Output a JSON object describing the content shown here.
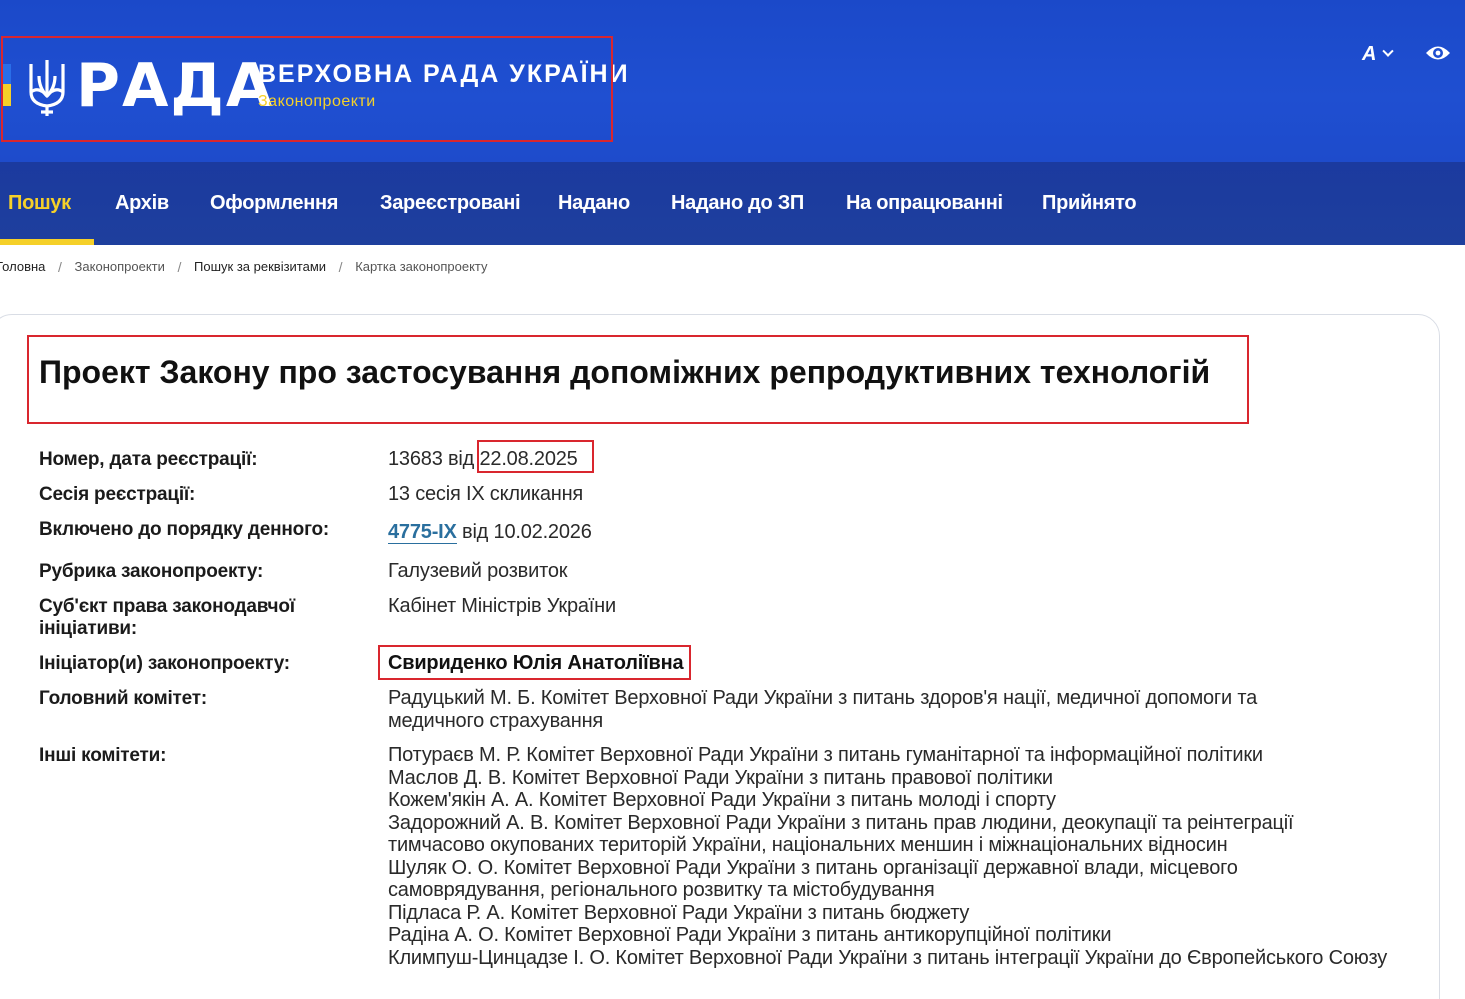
{
  "header": {
    "logo_word": "РАДА",
    "title": "ВЕРХОВНА РАДА УКРАЇНИ",
    "subtitle": "Законопроекти",
    "font_toggle_label": "A"
  },
  "nav": {
    "items": [
      {
        "label": "Пошук",
        "active": true
      },
      {
        "label": "Архів"
      },
      {
        "label": "Оформлення"
      },
      {
        "label": "Зареєстровані"
      },
      {
        "label": "Надано"
      },
      {
        "label": "Надано до ЗП"
      },
      {
        "label": "На опрацюванні"
      },
      {
        "label": "Прийнято"
      }
    ]
  },
  "breadcrumb": {
    "items": [
      "Головна",
      "Законопроекти",
      "Пошук за реквізитами",
      "Картка законопроекту"
    ],
    "separator": "/"
  },
  "bill": {
    "title": "Проект Закону про застосування допоміжних репродуктивних технологій",
    "rows": {
      "number": {
        "label": "Номер, дата реєстрації:",
        "number": "13683",
        "from": "від",
        "date": "22.08.2025"
      },
      "session": {
        "label": "Сесія реєстрації:",
        "value": "13 сесія IX скликання"
      },
      "agenda": {
        "label": "Включено до порядку денного:",
        "link": "4775-IX",
        "from": "від",
        "date": "10.02.2026"
      },
      "rubric": {
        "label": "Рубрика законопроекту:",
        "value": "Галузевий розвиток"
      },
      "subject": {
        "label": "Суб'єкт права законодавчої ініціативи:",
        "value": "Кабінет Міністрів України"
      },
      "initiator": {
        "label": "Ініціатор(и) законопроекту:",
        "value": "Свириденко Юлія Анатоліївна"
      },
      "main_committee": {
        "label": "Головний комітет:",
        "value": "Радуцький М. Б. Комітет Верховної Ради України з питань здоров'я нації, медичної допомоги та медичного страхування"
      },
      "other_committees": {
        "label": "Інші комітети:",
        "values": [
          "Потураєв М. Р. Комітет Верховної Ради України з питань гуманітарної та інформаційної політики",
          "Маслов Д. В. Комітет Верховної Ради України з питань правової політики",
          "Кожем'якін А. А. Комітет Верховної Ради України з питань молоді і спорту",
          "Задорожний А. В. Комітет Верховної Ради України з питань прав людини, деокупації та реінтеграції тимчасово окупованих територій України, національних меншин і міжнаціональних відносин",
          "Шуляк О. О. Комітет Верховної Ради України з питань організації державної влади, місцевого самоврядування, регіонального розвитку та містобудування",
          "Підласа Р. А. Комітет Верховної Ради України з питань бюджету",
          "Радіна А. О. Комітет Верховної Ради України з питань антикорупційної політики",
          "Климпуш-Цинцадзе І. О. Комітет Верховної Ради України з питань інтеграції України до Європейського Союзу"
        ]
      }
    }
  },
  "colors": {
    "header_blue": "#1f4fd1",
    "nav_blue": "#1e3f9d",
    "accent_yellow": "#f5d029",
    "link_blue": "#2a6f9e",
    "highlight_red": "#d9262e"
  }
}
